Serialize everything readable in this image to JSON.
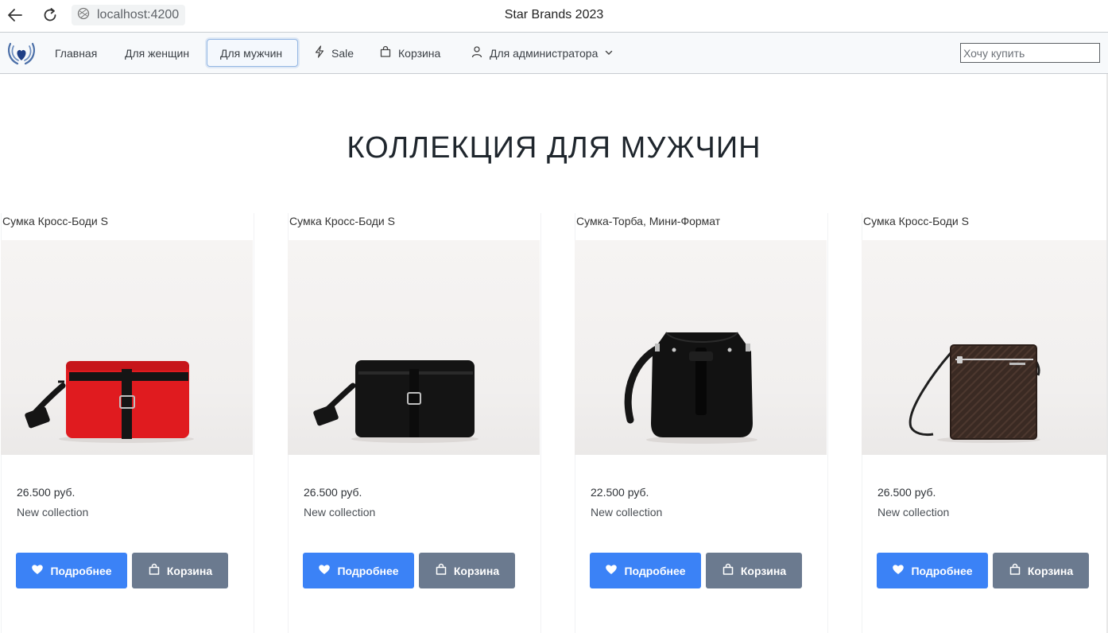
{
  "browser": {
    "url": "localhost:4200",
    "window_title": "Star Brands 2023"
  },
  "nav": {
    "items": [
      {
        "label": "Главная",
        "icon": "",
        "active": false
      },
      {
        "label": "Для женщин",
        "icon": "",
        "active": false
      },
      {
        "label": "Для мужчин",
        "icon": "",
        "active": true
      },
      {
        "label": "Sale",
        "icon": "bolt-icon",
        "active": false
      },
      {
        "label": "Корзина",
        "icon": "shopping-bag-icon",
        "active": false
      },
      {
        "label": "Для администратора",
        "icon": "user-icon",
        "active": false,
        "dropdown": true
      }
    ],
    "search_placeholder": "Хочу купить"
  },
  "page": {
    "title": "КОЛЛЕКЦИЯ ДЛЯ МУЖЧИН"
  },
  "products": [
    {
      "title": "Сумка Кросс-Боди S",
      "price": "26.500 руб.",
      "note": "New collection",
      "details_label": "Подробнее",
      "cart_label": "Корзина",
      "bag_color": "#e01b1f",
      "bag_type": "crossbody-red"
    },
    {
      "title": "Сумка Кросс-Боди S",
      "price": "26.500 руб.",
      "note": "New collection",
      "details_label": "Подробнее",
      "cart_label": "Корзина",
      "bag_color": "#141414",
      "bag_type": "crossbody-black"
    },
    {
      "title": "Сумка-Торба, Мини-Формат",
      "price": "22.500 руб.",
      "note": "New collection",
      "details_label": "Подробнее",
      "cart_label": "Корзина",
      "bag_color": "#111111",
      "bag_type": "bucket"
    },
    {
      "title": "Сумка Кросс-Боди S",
      "price": "26.500 руб.",
      "note": "New collection",
      "details_label": "Подробнее",
      "cart_label": "Корзина",
      "bag_color": "#3a2a23",
      "bag_type": "messenger-brown"
    }
  ],
  "colors": {
    "primary_button": "#3b82f6",
    "secondary_button": "#6b7a8f"
  }
}
